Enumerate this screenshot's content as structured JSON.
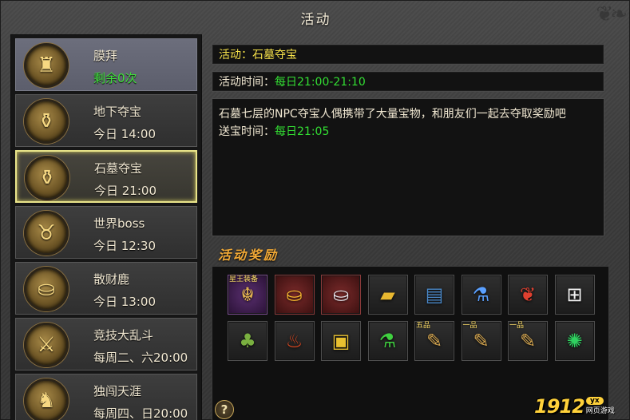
{
  "window": {
    "title": "活动"
  },
  "activities": [
    {
      "name": "膜拜",
      "time": "剩余0次",
      "time_color": "green",
      "icon": "warrior-statue-icon",
      "glyph": "♜"
    },
    {
      "name": "地下夺宝",
      "time": "今日 14:00",
      "time_color": "normal",
      "icon": "treasure-chest-icon",
      "glyph": "⚱"
    },
    {
      "name": "石墓夺宝",
      "time": "今日 21:00",
      "time_color": "normal",
      "icon": "open-chest-icon",
      "glyph": "⚱",
      "selected": true
    },
    {
      "name": "世界boss",
      "time": "今日 12:30",
      "time_color": "normal",
      "icon": "bull-demon-icon",
      "glyph": "♉"
    },
    {
      "name": "散财鹿",
      "time": "今日 13:00",
      "time_color": "normal",
      "icon": "gold-ingot-icon",
      "glyph": "⛀"
    },
    {
      "name": "竞技大乱斗",
      "time": "每周二、六20:00",
      "time_color": "normal",
      "icon": "crossed-swords-icon",
      "glyph": "⚔"
    },
    {
      "name": "独闯天涯",
      "time": "每周四、日20:00",
      "time_color": "normal",
      "icon": "lone-warrior-icon",
      "glyph": "♞"
    }
  ],
  "detail": {
    "title_prefix": "活动：",
    "title_value": "石墓夺宝",
    "time_prefix": "活动时间：",
    "time_value": "每日21:00-21:10",
    "description": "石墓七层的NPC夺宝人偶携带了大量宝物，和朋友们一起去夺取奖励吧",
    "send_prefix": "送宝时间：",
    "send_value": "每日21:05"
  },
  "rewards": {
    "label": "活动奖励",
    "items": [
      {
        "icon": "star-king-equipment-icon",
        "glyph": "☬",
        "tag": "星王装备",
        "style": "purple",
        "color": "#e0b050"
      },
      {
        "icon": "gold-ingot-icon",
        "glyph": "⛀",
        "tag": "",
        "style": "red",
        "color": "#ffc030"
      },
      {
        "icon": "silver-ingot-icon",
        "glyph": "⛀",
        "tag": "",
        "style": "red",
        "color": "#e8e8f0"
      },
      {
        "icon": "gold-bar-icon",
        "glyph": "▰",
        "tag": "",
        "style": "",
        "color": "#e8b830"
      },
      {
        "icon": "skill-book-icon",
        "glyph": "▤",
        "tag": "",
        "style": "",
        "color": "#4a88c8"
      },
      {
        "icon": "blue-potion-icon",
        "glyph": "⚗",
        "tag": "",
        "style": "",
        "color": "#5aa0ff"
      },
      {
        "icon": "red-dragon-icon",
        "glyph": "❦",
        "tag": "",
        "style": "",
        "color": "#e04030"
      },
      {
        "icon": "gift-box-icon",
        "glyph": "⊞",
        "tag": "",
        "style": "",
        "color": "#f0f0f0"
      },
      {
        "icon": "gourd-bag-icon",
        "glyph": "♣",
        "tag": "",
        "style": "",
        "color": "#7ab040"
      },
      {
        "icon": "lucky-bag-icon",
        "glyph": "♨",
        "tag": "",
        "style": "",
        "color": "#e04820"
      },
      {
        "icon": "red-gift-box-icon",
        "glyph": "▣",
        "tag": "",
        "style": "",
        "color": "#e8c030"
      },
      {
        "icon": "green-potion-icon",
        "glyph": "⚗",
        "tag": "",
        "style": "",
        "color": "#40d040"
      },
      {
        "icon": "scroll-icon",
        "glyph": "✎",
        "tag": "五品",
        "style": "",
        "color": "#d8a850"
      },
      {
        "icon": "scroll-icon",
        "glyph": "✎",
        "tag": "一品",
        "style": "",
        "color": "#d8a850"
      },
      {
        "icon": "scroll-icon",
        "glyph": "✎",
        "tag": "一品",
        "style": "",
        "color": "#d8a850"
      },
      {
        "icon": "jade-orb-icon",
        "glyph": "✺",
        "tag": "",
        "style": "",
        "color": "#30d060"
      }
    ]
  },
  "help_button": "?",
  "watermark": {
    "number": "1912",
    "badge": "yx",
    "sub": "网页游戏"
  }
}
